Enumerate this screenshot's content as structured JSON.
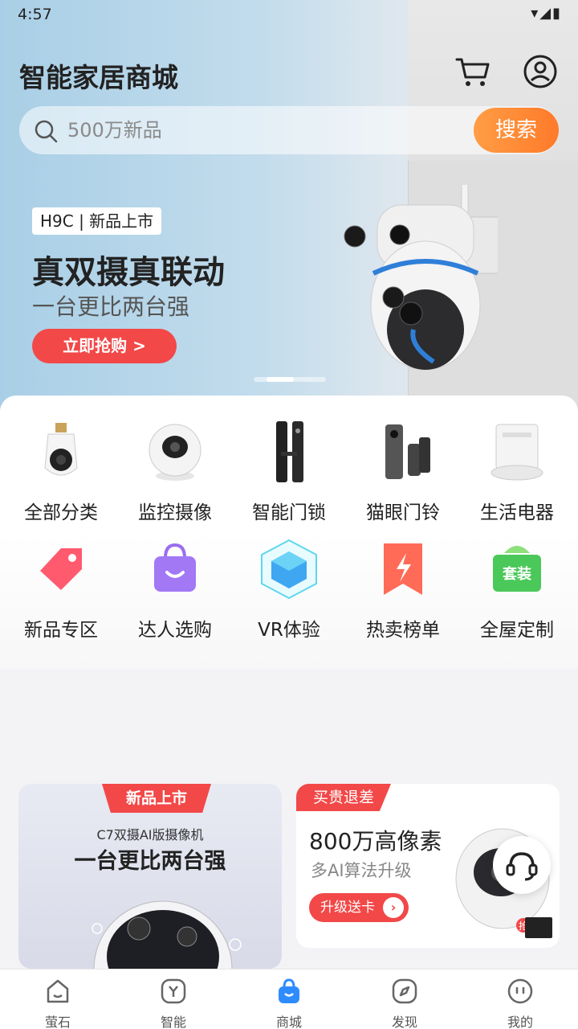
{
  "status": {
    "time": "4:57",
    "icons": "▾◢▮"
  },
  "header": {
    "title": "智能家居商城"
  },
  "search": {
    "placeholder": "500万新品",
    "button": "搜索"
  },
  "banner": {
    "tag": "H9C | 新品上市",
    "headline": "真双摄真联动",
    "subline": "一台更比两台强",
    "cta": "立即抢购  >"
  },
  "categories": [
    {
      "label": "全部分类",
      "icon": "bulb-camera-icon"
    },
    {
      "label": "监控摄像",
      "icon": "dome-camera-icon"
    },
    {
      "label": "智能门锁",
      "icon": "smart-lock-icon"
    },
    {
      "label": "猫眼门铃",
      "icon": "doorbell-icon"
    },
    {
      "label": "生活电器",
      "icon": "robot-vacuum-icon"
    },
    {
      "label": "新品专区",
      "icon": "tag-icon"
    },
    {
      "label": "达人选购",
      "icon": "shopping-bag-icon"
    },
    {
      "label": "VR体验",
      "icon": "vr-cube-icon"
    },
    {
      "label": "热卖榜单",
      "icon": "bookmark-flash-icon"
    },
    {
      "label": "全屋定制",
      "icon": "package-icon"
    }
  ],
  "package_text": "套装",
  "promo_left": {
    "ribbon": "新品上市",
    "model": "C7双摄AI版摄像机",
    "slogan": "一台更比两台强"
  },
  "promo_right": {
    "ribbon": "买贵退差",
    "title": "800万高像素",
    "subtitle": "多AI算法升级",
    "button": "升级送卡",
    "badge": "抢"
  },
  "tabs": [
    {
      "label": "萤石",
      "icon": "home-icon"
    },
    {
      "label": "智能",
      "icon": "smart-icon"
    },
    {
      "label": "商城",
      "icon": "mall-bag-icon"
    },
    {
      "label": "发现",
      "icon": "compass-icon"
    },
    {
      "label": "我的",
      "icon": "profile-face-icon"
    }
  ],
  "colors": {
    "accent": "#f24848",
    "search_button": "#ff8a35",
    "mall_tab": "#2f8cff"
  }
}
